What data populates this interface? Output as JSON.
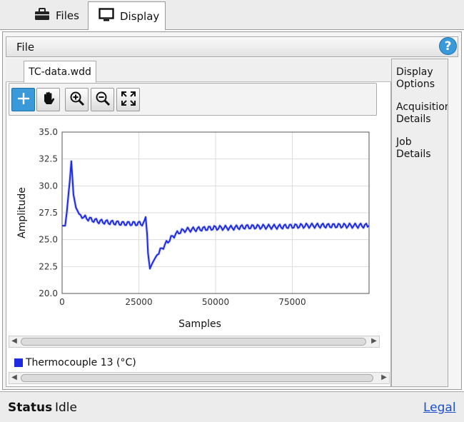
{
  "tabs": [
    {
      "label": "Files",
      "icon": "briefcase-icon"
    },
    {
      "label": "Display",
      "icon": "monitor-icon"
    }
  ],
  "file_menu": {
    "label": "File"
  },
  "help": {
    "label": "?"
  },
  "doc_tab": {
    "label": "TC-data.wdd"
  },
  "toolbar": {
    "buttons": [
      "crosshair-icon",
      "pan-hand-icon",
      "zoom-in-icon",
      "zoom-out-icon",
      "fit-expand-icon"
    ]
  },
  "side_panel": {
    "items": [
      {
        "label": "Display\nOptions"
      },
      {
        "label": "Acquisition\nDetails"
      },
      {
        "label": "Job\nDetails"
      }
    ]
  },
  "legend": {
    "label": "Thermocouple 13 (°C)",
    "color": "#1f2be0"
  },
  "status": {
    "label": "Status",
    "value": "Idle"
  },
  "legal": {
    "label": "Legal"
  },
  "chart_data": {
    "type": "line",
    "xlabel": "Samples",
    "ylabel": "Amplitude",
    "xlim": [
      0,
      100000
    ],
    "ylim": [
      20.0,
      35.0
    ],
    "xticks": [
      0,
      25000,
      50000,
      75000
    ],
    "xtick_labels": [
      "0",
      "25000",
      "50000",
      "75000"
    ],
    "yticks": [
      20.0,
      22.5,
      25.0,
      27.5,
      30.0,
      32.5,
      35.0
    ],
    "ytick_labels": [
      "20.0",
      "22.5",
      "25.0",
      "27.5",
      "30.0",
      "32.5",
      "35.0"
    ],
    "grid": true,
    "series": [
      {
        "name": "Thermocouple 13 (°C)",
        "color": "#1f2be0",
        "x": [
          0,
          1000,
          1500,
          2500,
          3000,
          3300,
          3700,
          4500,
          5500,
          7000,
          9000,
          12000,
          16000,
          20000,
          24000,
          26500,
          27200,
          27700,
          28000,
          28600,
          29200,
          30500,
          32000,
          34000,
          36000,
          38000,
          40000,
          45000,
          50000,
          55000,
          60000,
          70000,
          80000,
          90000,
          100000
        ],
        "y": [
          26.3,
          26.3,
          27.5,
          30.5,
          32.3,
          31.0,
          29.2,
          28.0,
          27.4,
          27.1,
          26.9,
          26.7,
          26.6,
          26.5,
          26.5,
          26.5,
          27.1,
          25.5,
          23.7,
          22.3,
          22.7,
          23.4,
          24.0,
          24.7,
          25.3,
          25.7,
          25.9,
          26.0,
          26.1,
          26.1,
          26.2,
          26.2,
          26.3,
          26.3,
          26.3
        ]
      }
    ]
  }
}
